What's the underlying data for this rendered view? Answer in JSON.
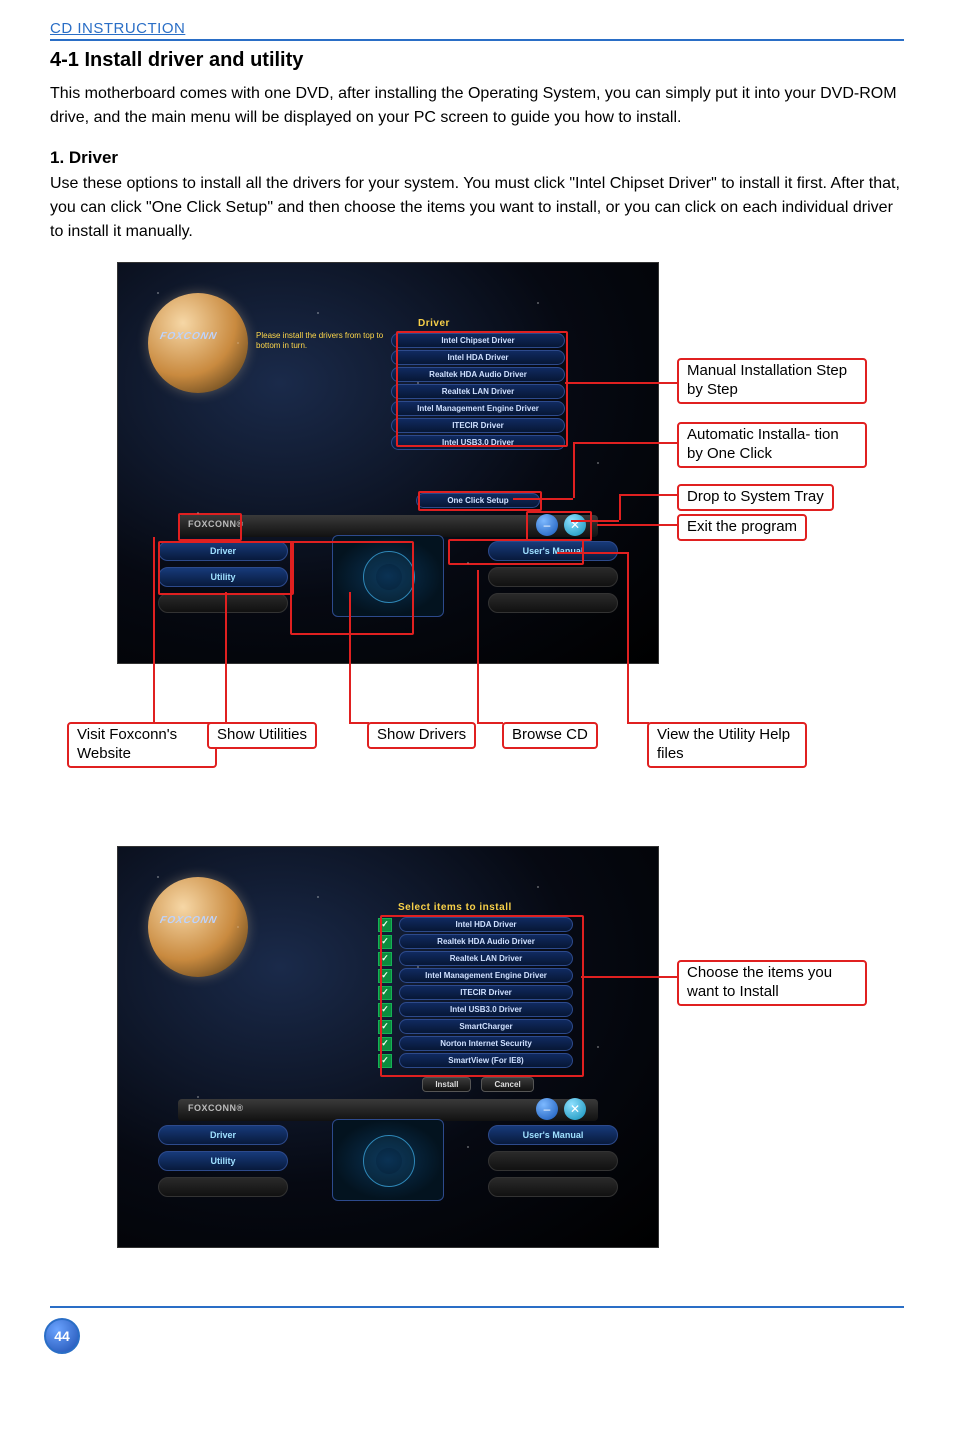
{
  "header": {
    "section": "CD INSTRUCTION"
  },
  "title": "4-1 Install driver and utility",
  "intro": "This motherboard comes with one DVD, after installing the Operating System, you can simply put it into your DVD-ROM drive, and the main menu will be displayed on your PC screen to guide you how to install.",
  "driver": {
    "heading": "1. Driver",
    "body": "Use these options to install all the drivers for your system. You must click \"Intel Chipset Driver\" to install it first. After that, you can click \"One Click Setup\" and then choose the items you want to install, or you can click on each individual driver to install it manually."
  },
  "fig1": {
    "logo": "FOXCONN",
    "helptext": "Please install the drivers from top to bottom in turn.",
    "panel_title": "Driver",
    "drivers": [
      "Intel Chipset Driver",
      "Intel HDA Driver",
      "Realtek HDA  Audio Driver",
      "Realtek LAN Driver",
      "Intel Management Engine Driver",
      "ITECIR Driver",
      "Intel USB3.0 Driver"
    ],
    "one_click": "One Click Setup",
    "brand": "FOXCONN®",
    "tray_min_glyph": "–",
    "tray_close_glyph": "✕",
    "nav": {
      "driver": "Driver",
      "utility": "Utility",
      "manual": "User's Manual"
    },
    "callouts": {
      "manual_step": "Manual Installation Step by Step",
      "auto": "Automatic Installa-\ntion by One Click",
      "tray": "Drop to System Tray",
      "exit": "Exit the program",
      "visit": "Visit Foxconn's Website",
      "utilities": "Show Utilities",
      "drivers": "Show Drivers",
      "browse": "Browse CD",
      "help": "View the Utility Help files"
    }
  },
  "fig2": {
    "logo": "FOXCONN",
    "panel_title": "Select items to install",
    "items": [
      "Intel HDA Driver",
      "Realtek HDA  Audio Driver",
      "Realtek LAN Driver",
      "Intel Management Engine Driver",
      "ITECIR Driver",
      "Intel USB3.0 Driver",
      "SmartCharger",
      "Norton Internet Security",
      "SmartView (For IE8)"
    ],
    "install": "Install",
    "cancel": "Cancel",
    "brand": "FOXCONN®",
    "nav": {
      "driver": "Driver",
      "utility": "Utility",
      "manual": "User's Manual"
    },
    "callout": "Choose the items you want to Install"
  },
  "page_number": "44"
}
